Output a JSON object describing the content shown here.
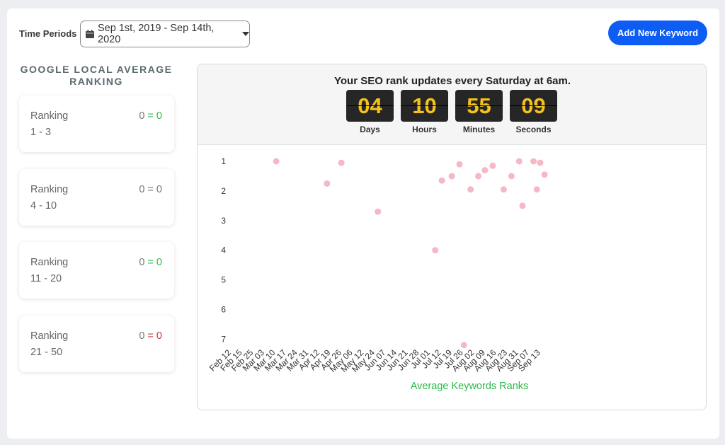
{
  "filter": {
    "label": "Time Periods",
    "value": "Sep 1st, 2019 - Sep 14th, 2020",
    "icons": {
      "calendar": "calendar-icon",
      "caret": "caret-down-icon"
    }
  },
  "add_button": {
    "label": "Add New Keyword",
    "color": "#0d5cf4"
  },
  "sidebar": {
    "title": "GOOGLE LOCAL AVERAGE RANKING",
    "cards": [
      {
        "label": "Ranking",
        "range": "1 - 3",
        "left": "0",
        "eq": "=",
        "right": "0",
        "color": "#2db84c"
      },
      {
        "label": "Ranking",
        "range": "4 - 10",
        "left": "0",
        "eq": "=",
        "right": "0",
        "color": "#777777"
      },
      {
        "label": "Ranking",
        "range": "11 - 20",
        "left": "0",
        "eq": "=",
        "right": "0",
        "color": "#2db84c"
      },
      {
        "label": "Ranking",
        "range": "21 - 50",
        "left": "0",
        "eq": "=",
        "right": "0",
        "color": "#c0392b"
      }
    ]
  },
  "timer": {
    "title": "Your SEO rank updates every Saturday at 6am.",
    "units": [
      {
        "value": "04",
        "label": "Days"
      },
      {
        "value": "10",
        "label": "Hours"
      },
      {
        "value": "55",
        "label": "Minutes"
      },
      {
        "value": "09",
        "label": "Seconds"
      }
    ]
  },
  "chart_data": {
    "type": "scatter",
    "title": "",
    "xlabel": "Average Keywords Ranks",
    "ylabel": "",
    "ylim": [
      1,
      7
    ],
    "y_reversed": true,
    "y_ticks": [
      "1",
      "2",
      "3",
      "4",
      "5",
      "6",
      "7"
    ],
    "categories": [
      "Feb 12",
      "Feb 15",
      "Feb 25",
      "Mar 03",
      "Mar 10",
      "Mar 17",
      "Mar 24",
      "Mar 31",
      "Apr 12",
      "Apr 19",
      "Apr 26",
      "May 06",
      "May 12",
      "May 24",
      "Jun 07",
      "Jun 14",
      "Jun 21",
      "Jun 28",
      "Jul 01",
      "Jul 12",
      "Jul 19",
      "Jul 26",
      "Aug 02",
      "Aug 09",
      "Aug 16",
      "Aug 23",
      "Aug 31",
      "Sep 07",
      "Sep 13"
    ],
    "points": [
      {
        "x": 4.3,
        "y": 1.0
      },
      {
        "x": 8.9,
        "y": 1.75
      },
      {
        "x": 10.2,
        "y": 1.05
      },
      {
        "x": 13.5,
        "y": 2.7
      },
      {
        "x": 18.7,
        "y": 4.0
      },
      {
        "x": 19.3,
        "y": 1.65
      },
      {
        "x": 20.2,
        "y": 1.5
      },
      {
        "x": 20.9,
        "y": 1.1
      },
      {
        "x": 21.3,
        "y": 7.2
      },
      {
        "x": 21.9,
        "y": 1.95
      },
      {
        "x": 22.6,
        "y": 1.5
      },
      {
        "x": 23.2,
        "y": 1.3
      },
      {
        "x": 23.9,
        "y": 1.15
      },
      {
        "x": 24.9,
        "y": 1.95
      },
      {
        "x": 25.6,
        "y": 1.5
      },
      {
        "x": 26.3,
        "y": 1.0
      },
      {
        "x": 26.6,
        "y": 2.5
      },
      {
        "x": 27.6,
        "y": 1.0
      },
      {
        "x": 27.9,
        "y": 1.95
      },
      {
        "x": 28.2,
        "y": 1.05
      },
      {
        "x": 28.6,
        "y": 1.45
      }
    ],
    "point_color": "#f5b8c4",
    "label_color": "#2db84c",
    "grid": false,
    "legend": "none"
  }
}
